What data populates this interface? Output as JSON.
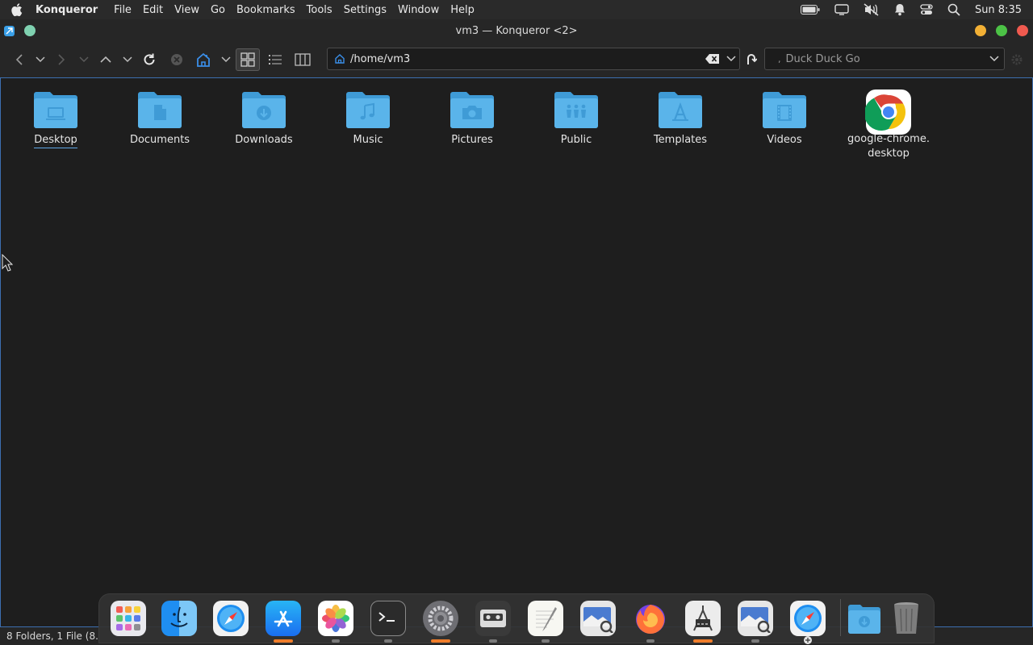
{
  "menubar": {
    "app_name": "Konqueror",
    "items": [
      "File",
      "Edit",
      "View",
      "Go",
      "Bookmarks",
      "Tools",
      "Settings",
      "Window",
      "Help"
    ],
    "clock": "Sun 8:35"
  },
  "window": {
    "title": "vm3 — Konqueror <2>"
  },
  "toolbar": {
    "url": "/home/vm3",
    "search_placeholder": "Duck Duck Go"
  },
  "files": [
    {
      "name": "Desktop",
      "icon": "desktop-folder-icon"
    },
    {
      "name": "Documents",
      "icon": "documents-folder-icon"
    },
    {
      "name": "Downloads",
      "icon": "downloads-folder-icon"
    },
    {
      "name": "Music",
      "icon": "music-folder-icon"
    },
    {
      "name": "Pictures",
      "icon": "pictures-folder-icon"
    },
    {
      "name": "Public",
      "icon": "public-folder-icon"
    },
    {
      "name": "Templates",
      "icon": "templates-folder-icon"
    },
    {
      "name": "Videos",
      "icon": "videos-folder-icon"
    },
    {
      "name": "google-chrome.\ndesktop",
      "icon": "chrome-icon"
    }
  ],
  "status": {
    "text": "8 Folders, 1 File (8."
  },
  "dock": {
    "apps": [
      "launchpad",
      "finder",
      "safari",
      "app-store",
      "photos",
      "terminal",
      "system-preferences",
      "cassette",
      "textedit",
      "preview",
      "firefox",
      "instruments",
      "preview-2",
      "safari-2",
      "downloads",
      "trash"
    ]
  },
  "colors": {
    "folder": "#5ab4ea",
    "accent": "#3d6fb0",
    "indicator": "#f07d2a"
  }
}
